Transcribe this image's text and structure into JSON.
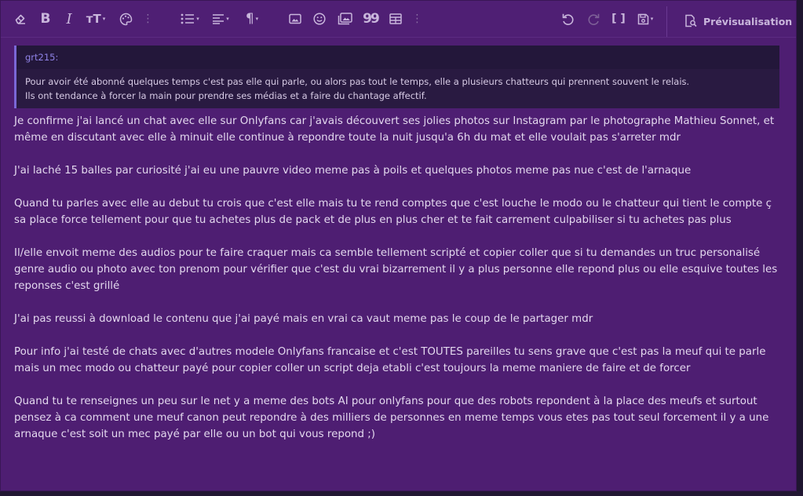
{
  "toolbar": {
    "caret": "▾",
    "more": "⋮",
    "paragraph_glyph": "¶",
    "quote_glyph": "99",
    "brackets_glyph": "[ ]",
    "text_size_glyph": "тT",
    "bold_glyph": "B",
    "italic_glyph": "I",
    "preview_label": "Prévisualisation"
  },
  "quote": {
    "author": "grt215:",
    "lines": [
      "Pour avoir été abonné quelques temps c'est pas elle qui parle, ou alors pas tout le temps, elle a plusieurs chatteurs qui prennent souvent le relais.",
      "Ils ont tendance à forcer la main pour prendre ses médias et a faire du chantage affectif."
    ]
  },
  "paragraphs": [
    "Je confirme j'ai lancé un chat avec elle sur Onlyfans car j'avais découvert ses jolies photos sur Instagram par le photographe Mathieu Sonnet, et même en discutant avec elle à minuit elle continue à repondre toute la nuit jusqu'a 6h du mat et elle voulait pas s'arreter mdr",
    "J'ai laché 15 balles par curiosité j'ai eu une pauvre video meme pas à poils et quelques photos meme pas nue c'est de l'arnaque",
    "Quand tu parles avec elle au debut tu crois que c'est elle mais tu te rend comptes que c'est louche le modo ou le chatteur qui tient le compte ç sa place force tellement pour que tu achetes plus de pack et de plus en plus cher et te fait carrement culpabiliser si tu achetes pas plus",
    "Il/elle envoit meme des audios pour te faire craquer mais ca semble tellement scripté et copier coller que si tu demandes un truc personalisé genre audio ou photo avec ton prenom pour vérifier que c'est du vrai bizarrement il y a plus personne elle repond plus ou elle esquive toutes les reponses c'est grillé",
    "J'ai pas reussi à download le contenu que j'ai payé mais en vrai ca vaut meme pas le coup de le partager mdr",
    "Pour info j'ai testé de chats avec d'autres modele Onlyfans francaise et c'est TOUTES pareilles tu sens grave que c'est pas la meuf qui te parle mais un mec modo ou chatteur payé pour copier coller un script deja etabli c'est toujours la meme maniere de faire et de forcer",
    "Quand tu te renseignes un peu sur le net y a meme des bots AI pour onlyfans pour que des robots repondent à la place des meufs et surtout pensez à ca comment une meuf canon peut repondre à des milliers de personnes en meme temps vous etes pas tout seul forcement il y a une arnaque c'est soit un mec payé par elle ou un bot qui vous repond ;)"
  ]
}
